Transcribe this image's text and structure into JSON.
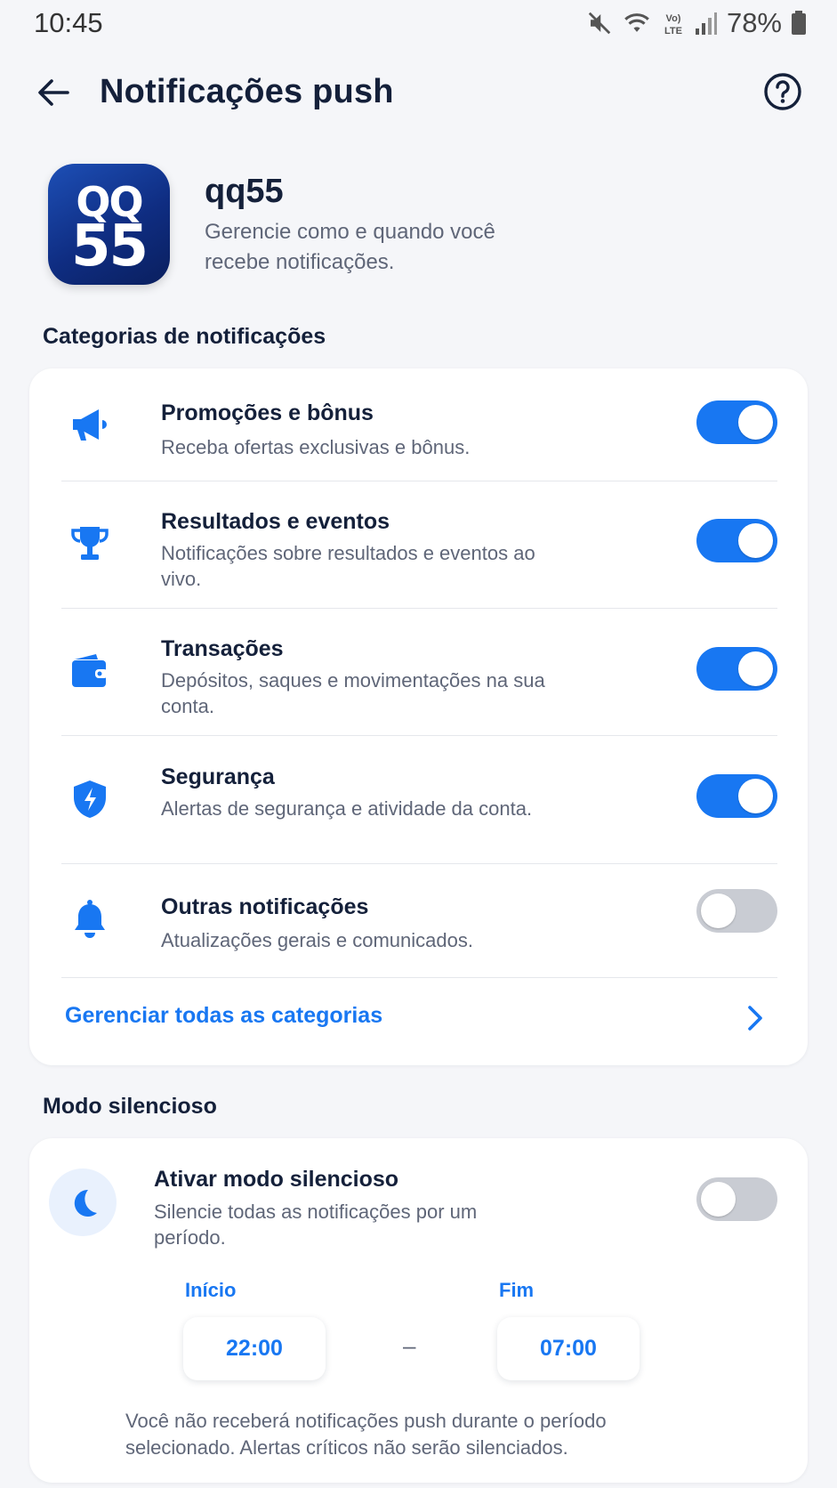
{
  "status_bar": {
    "time": "10:45",
    "network_label": "Vo) LTE",
    "battery": "78%"
  },
  "header": {
    "title": "Notificações push",
    "back_icon": "arrow-left-icon",
    "help_icon": "help-circle-icon"
  },
  "app": {
    "name": "qq55",
    "logo_line1": "QQ",
    "logo_line2": "55",
    "description": "Gerencie como e quando você recebe notificações."
  },
  "categories": {
    "section_title": "Categorias de notificações",
    "items": [
      {
        "icon": "megaphone-icon",
        "title": "Promoções e bônus",
        "subtitle": "Receba ofertas exclusivas e bônus.",
        "enabled": true
      },
      {
        "icon": "trophy-icon",
        "title": "Resultados e eventos",
        "subtitle": "Notificações sobre resultados e eventos ao vivo.",
        "enabled": true
      },
      {
        "icon": "wallet-icon",
        "title": "Transações",
        "subtitle": "Depósitos, saques e movimentações na sua conta.",
        "enabled": true
      },
      {
        "icon": "shield-icon",
        "title": "Segurança",
        "subtitle": "Alertas de segurança e atividade da conta.",
        "enabled": true
      },
      {
        "icon": "bell-icon",
        "title": "Outras notificações",
        "subtitle": "Atualizações gerais e comunicados.",
        "enabled": false
      }
    ],
    "manage_label": "Gerenciar todas as categorias"
  },
  "silent_mode": {
    "section_title": "Modo silencioso",
    "title": "Ativar modo silencioso",
    "subtitle": "Silencie todas as notificações por um período.",
    "enabled": false,
    "start_label": "Início",
    "start_time": "22:00",
    "separator": "–",
    "end_label": "Fim",
    "end_time": "07:00",
    "note": "Você não receberá notificações push durante o período selecionado. Alertas críticos não serão silenciados."
  },
  "colors": {
    "accent": "#1877f2",
    "text_primary": "#14203a",
    "text_secondary": "#5f6678",
    "toggle_off": "#c9ccd3",
    "background": "#f5f6f9"
  }
}
